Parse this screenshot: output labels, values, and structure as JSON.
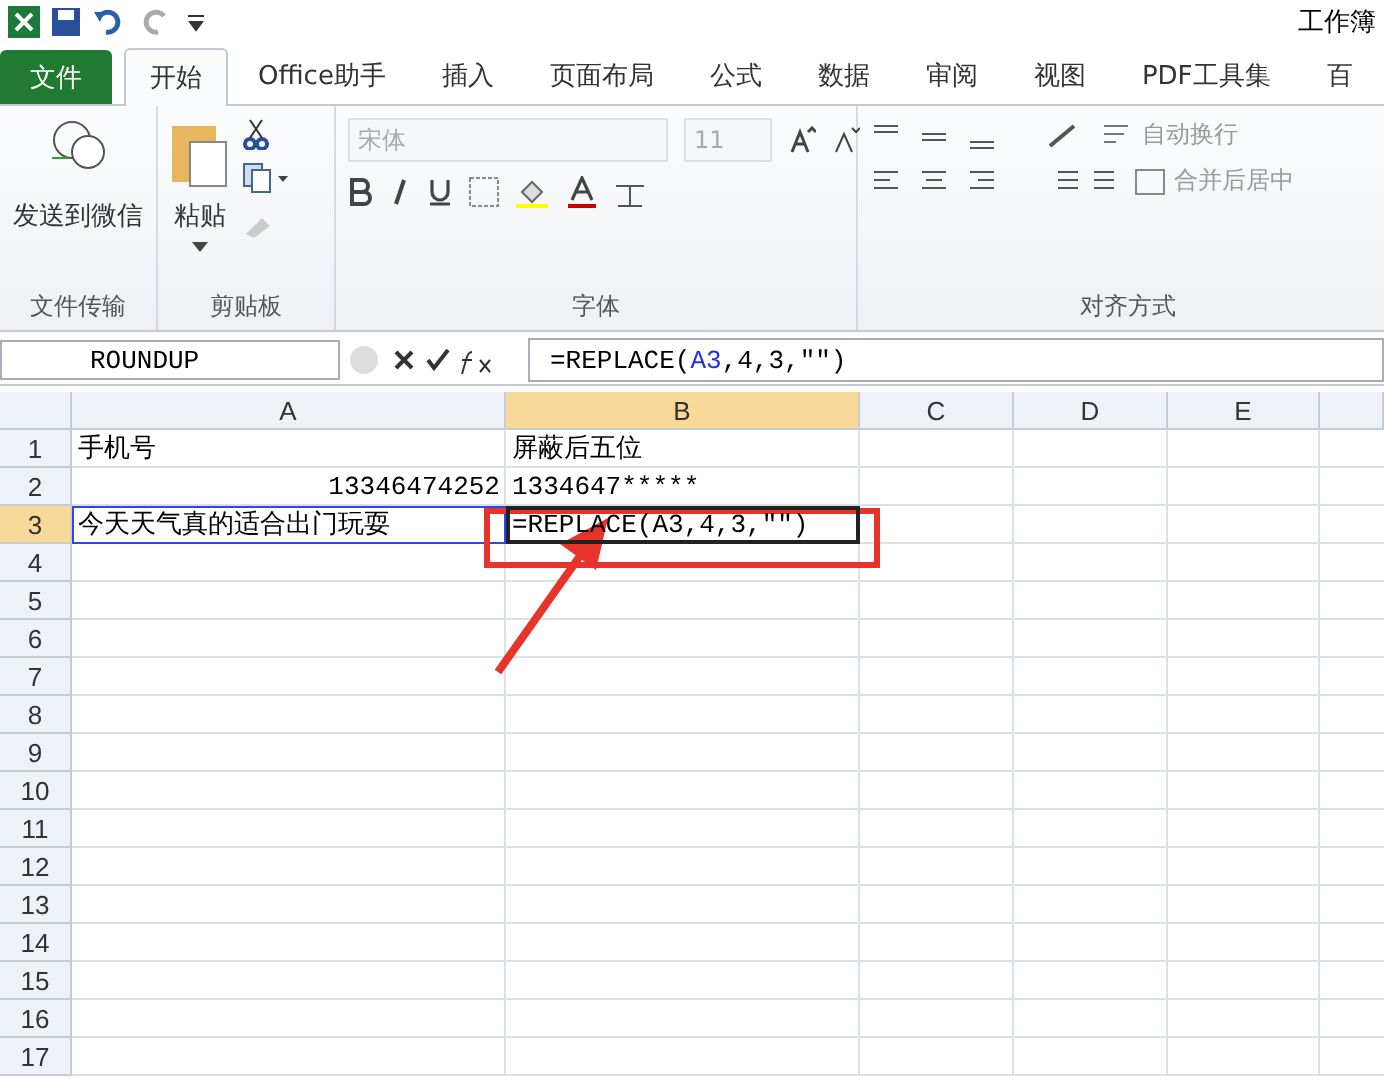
{
  "window": {
    "title": "工作簿"
  },
  "tabs": [
    {
      "label": "文件",
      "kind": "file",
      "selected": false
    },
    {
      "label": "开始",
      "kind": "tab",
      "selected": true
    },
    {
      "label": "Office助手",
      "kind": "tab",
      "selected": false
    },
    {
      "label": "插入",
      "kind": "tab",
      "selected": false
    },
    {
      "label": "页面布局",
      "kind": "tab",
      "selected": false
    },
    {
      "label": "公式",
      "kind": "tab",
      "selected": false
    },
    {
      "label": "数据",
      "kind": "tab",
      "selected": false
    },
    {
      "label": "审阅",
      "kind": "tab",
      "selected": false
    },
    {
      "label": "视图",
      "kind": "tab",
      "selected": false
    },
    {
      "label": "PDF工具集",
      "kind": "tab",
      "selected": false
    },
    {
      "label": "百",
      "kind": "tab",
      "selected": false
    }
  ],
  "ribbon": {
    "wechat": {
      "label": "发送到微信",
      "group": "文件传输"
    },
    "clipboard": {
      "paste": "粘贴",
      "group": "剪贴板"
    },
    "font": {
      "name": "宋体",
      "size": "11",
      "group": "字体"
    },
    "alignment": {
      "wrap": "自动换行",
      "merge": "合并后居中",
      "group": "对齐方式"
    }
  },
  "formula_bar": {
    "name_box": "ROUNDUP",
    "formula_start": "=REPLACE(",
    "formula_ref": "A3",
    "formula_end": ",4,3,\"\")"
  },
  "columns": [
    {
      "label": "A",
      "selected": false
    },
    {
      "label": "B",
      "selected": true
    },
    {
      "label": "C",
      "selected": false
    },
    {
      "label": "D",
      "selected": false
    },
    {
      "label": "E",
      "selected": false
    }
  ],
  "rows": [
    {
      "label": "1",
      "selected": false,
      "cells": [
        "手机号",
        "屏蔽后五位"
      ]
    },
    {
      "label": "2",
      "selected": false,
      "cells": [
        "13346474252",
        "1334647*****"
      ]
    },
    {
      "label": "3",
      "selected": true,
      "cells": [
        "今天天气真的适合出门玩耍",
        "=REPLACE(A3,4,3,\"\")"
      ]
    },
    {
      "label": "4",
      "selected": false,
      "cells": []
    },
    {
      "label": "5",
      "selected": false,
      "cells": []
    },
    {
      "label": "6",
      "selected": false,
      "cells": []
    },
    {
      "label": "7",
      "selected": false,
      "cells": []
    },
    {
      "label": "8",
      "selected": false,
      "cells": []
    },
    {
      "label": "9",
      "selected": false,
      "cells": []
    },
    {
      "label": "10",
      "selected": false,
      "cells": []
    },
    {
      "label": "11",
      "selected": false,
      "cells": []
    },
    {
      "label": "12",
      "selected": false,
      "cells": []
    },
    {
      "label": "13",
      "selected": false,
      "cells": []
    },
    {
      "label": "14",
      "selected": false,
      "cells": []
    },
    {
      "label": "15",
      "selected": false,
      "cells": []
    },
    {
      "label": "16",
      "selected": false,
      "cells": []
    },
    {
      "label": "17",
      "selected": false,
      "cells": []
    }
  ]
}
